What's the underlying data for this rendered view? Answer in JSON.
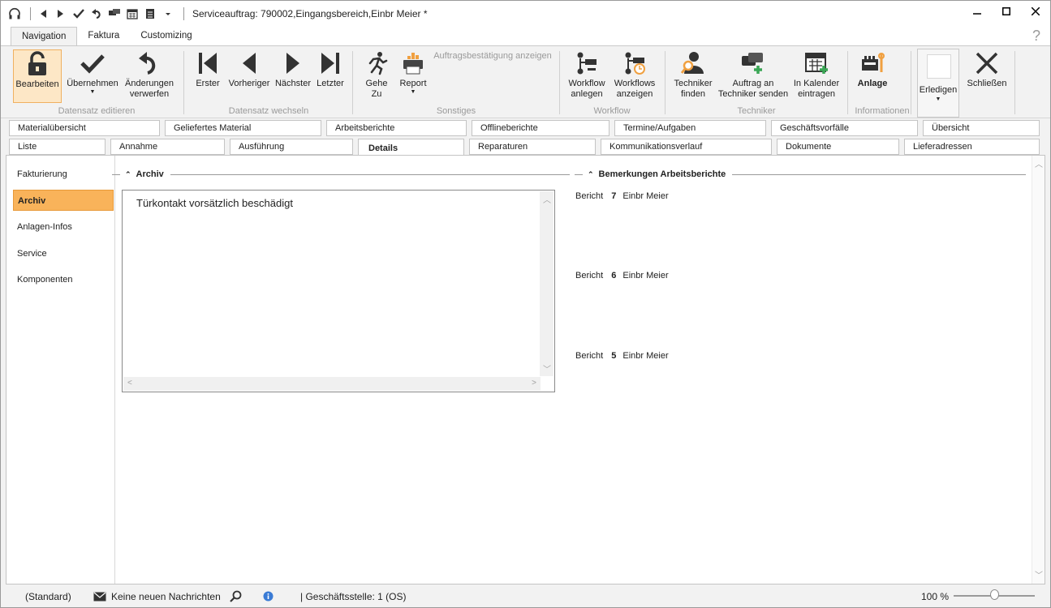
{
  "titlebar": {
    "title": "Serviceauftrag: 790002,Eingangsbereich,Einbr Meier *"
  },
  "ribbon_tabs": {
    "navigation": "Navigation",
    "faktura": "Faktura",
    "customizing": "Customizing",
    "help": "?"
  },
  "ribbon": {
    "bearbeiten": "Bearbeiten",
    "uebernehmen": "Übernehmen",
    "aenderungen_1": "Änderungen",
    "aenderungen_2": "verwerfen",
    "erster": "Erster",
    "vorheriger": "Vorheriger",
    "naechster": "Nächster",
    "letzter": "Letzter",
    "gehe_1": "Gehe",
    "gehe_2": "Zu",
    "report": "Report",
    "auftragsbestaetigung": "Auftragsbestätigung anzeigen",
    "workflow_anlegen_1": "Workflow",
    "workflow_anlegen_2": "anlegen",
    "workflows_anzeigen_1": "Workflows",
    "workflows_anzeigen_2": "anzeigen",
    "techniker_finden_1": "Techniker",
    "techniker_finden_2": "finden",
    "auftrag_senden_1": "Auftrag an",
    "auftrag_senden_2": "Techniker senden",
    "kalender_1": "In Kalender",
    "kalender_2": "eintragen",
    "anlage": "Anlage",
    "erledigen": "Erledigen",
    "schliessen": "Schließen",
    "groups": {
      "datensatz_editieren": "Datensatz editieren",
      "datensatz_wechseln": "Datensatz wechseln",
      "sonstiges": "Sonstiges",
      "workflow": "Workflow",
      "techniker": "Techniker",
      "informationen": "Informationen"
    }
  },
  "tabs_row1": [
    "Materialübersicht",
    "Geliefertes Material",
    "Arbeitsberichte",
    "Offlineberichte",
    "Termine/Aufgaben",
    "Geschäftsvorfälle",
    "Übersicht"
  ],
  "tabs_row2": [
    "Liste",
    "Annahme",
    "Ausführung",
    "Details",
    "Reparaturen",
    "Kommunikationsverlauf",
    "Dokumente",
    "Lieferadressen"
  ],
  "sidenav": [
    "Fakturierung",
    "Archiv",
    "Anlagen-Infos",
    "Service",
    "Komponenten"
  ],
  "archiv": {
    "heading": "Archiv",
    "text": "Türkontakt vorsätzlich beschädigt"
  },
  "bemerkungen": {
    "heading": "Bemerkungen Arbeitsberichte",
    "reports": [
      {
        "label": "Bericht",
        "number": "7",
        "name": "Einbr Meier"
      },
      {
        "label": "Bericht",
        "number": "6",
        "name": "Einbr Meier"
      },
      {
        "label": "Bericht",
        "number": "5",
        "name": "Einbr Meier"
      }
    ]
  },
  "statusbar": {
    "standard": "(Standard)",
    "messages": "Keine neuen Nachrichten",
    "geschaeftsstelle": "| Geschäftsstelle:  1 (OS)",
    "zoom": "100 %",
    "zoom_level": 0.5
  },
  "colors": {
    "accent": "#f9b35a",
    "highlight_border": "#f0b060",
    "info_blue": "#3a7bd5"
  }
}
